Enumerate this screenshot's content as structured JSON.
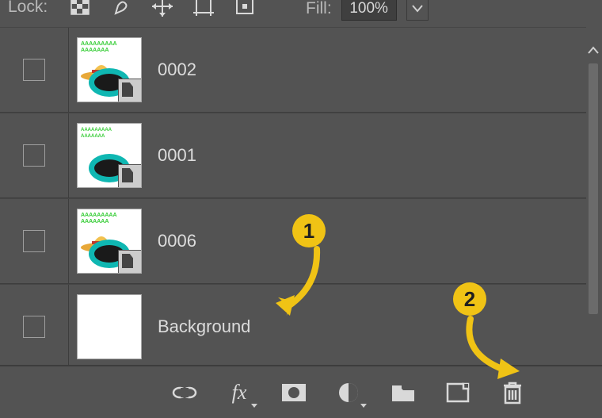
{
  "lockbar": {
    "label": "Lock:",
    "fill_label": "Fill:",
    "fill_value": "100%"
  },
  "layers": [
    {
      "name": "0002"
    },
    {
      "name": "0001"
    },
    {
      "name": "0006"
    },
    {
      "name": "Background"
    }
  ],
  "callouts": {
    "one": "1",
    "two": "2"
  },
  "bottom_icons": {
    "link": "link-icon",
    "fx": "fx-icon",
    "mask": "layer-mask-icon",
    "adjust": "adjustment-layer-icon",
    "group": "new-group-icon",
    "new": "new-layer-icon",
    "trash": "delete-layer-icon"
  }
}
